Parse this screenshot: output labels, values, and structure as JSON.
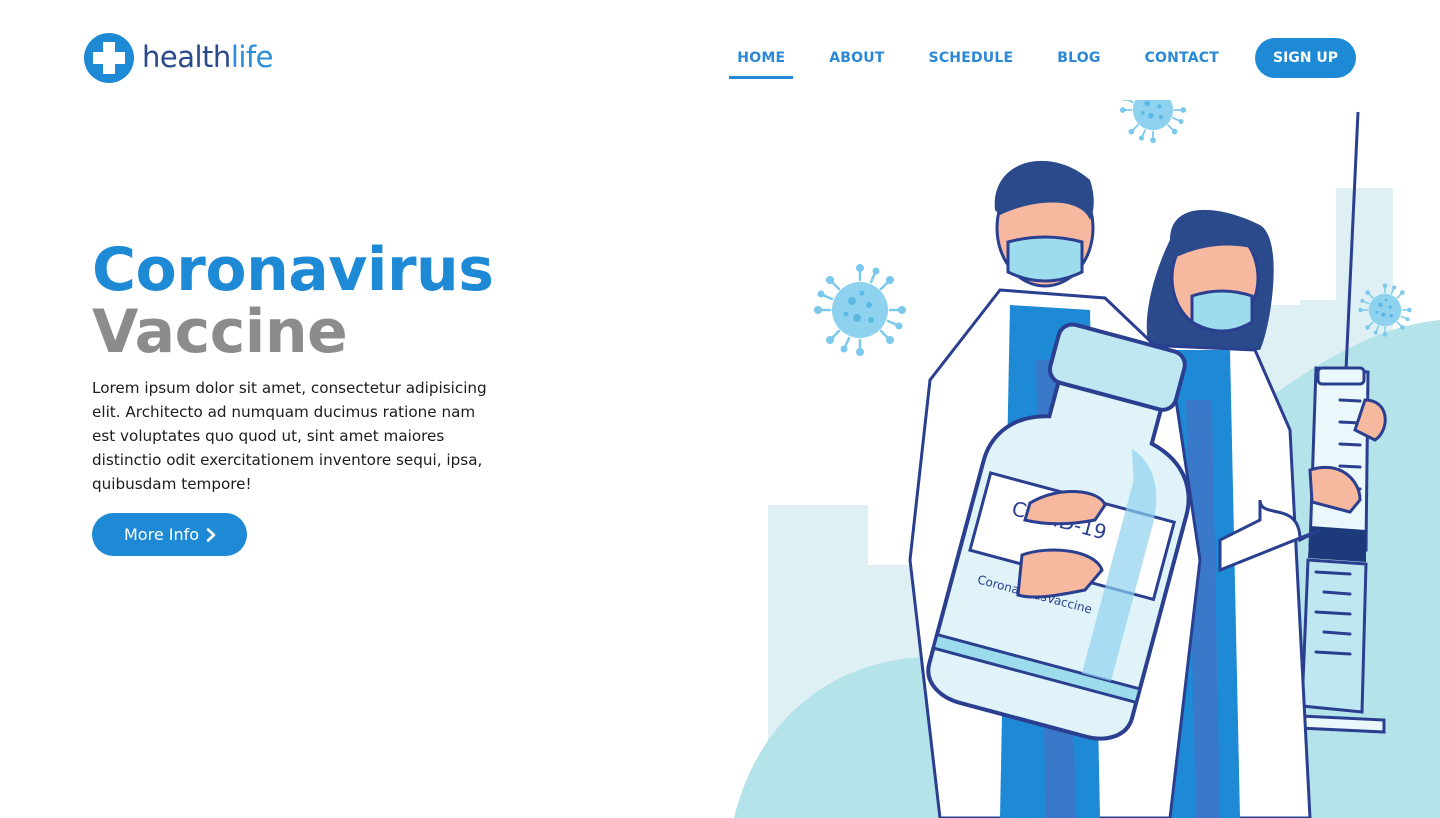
{
  "brand": {
    "name_strong": "health",
    "name_light": "life",
    "logo_icon": "medical-cross-icon",
    "primary_color": "#1e8ad6",
    "dark_color": "#2a4a8c"
  },
  "nav": {
    "items": [
      {
        "label": "HOME",
        "active": true
      },
      {
        "label": "ABOUT",
        "active": false
      },
      {
        "label": "SCHEDULE",
        "active": false
      },
      {
        "label": "BLOG",
        "active": false
      },
      {
        "label": "CONTACT",
        "active": false
      }
    ],
    "signup_label": "SIGN UP"
  },
  "hero": {
    "title_line1": "Coronavirus",
    "title_line2": "Vaccine",
    "description": "Lorem ipsum dolor sit amet, consectetur adipisicing elit. Architecto ad numquam ducimus ratione nam est voluptates quo quod ut, sint amet maiores distinctio odit exercitationem inventore sequi, ipsa, quibusdam tempore!",
    "cta_label": "More Info",
    "cta_icon": "chevron-right-icon"
  },
  "illustration": {
    "vial_label": "COVID-19",
    "vial_sublabel": "CoronavirusVaccine",
    "icons": [
      "virus-icon",
      "doctor-male-figure",
      "doctor-female-figure",
      "vaccine-vial-icon",
      "syringe-icon"
    ]
  }
}
